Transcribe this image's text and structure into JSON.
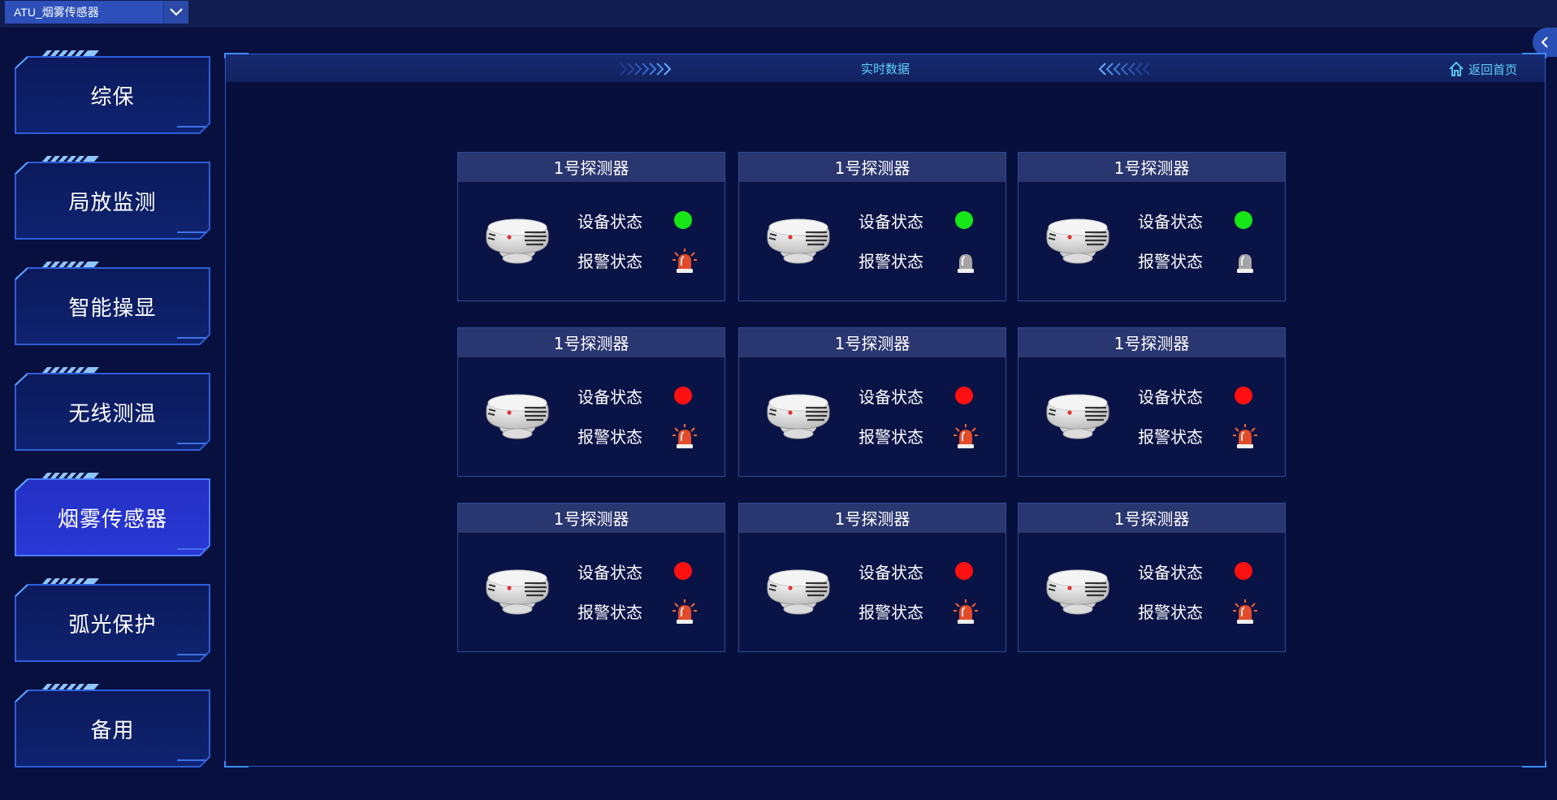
{
  "topbar": {
    "device_select_value": "ATU_烟雾传感器"
  },
  "sidebar": {
    "items": [
      {
        "label": "综保",
        "active": false
      },
      {
        "label": "局放监测",
        "active": false
      },
      {
        "label": "智能操显",
        "active": false
      },
      {
        "label": "无线测温",
        "active": false
      },
      {
        "label": "烟雾传感器",
        "active": true
      },
      {
        "label": "弧光保护",
        "active": false
      },
      {
        "label": "备用",
        "active": false
      }
    ]
  },
  "main": {
    "title": "实时数据",
    "home_label": "返回首页"
  },
  "detectors": [
    {
      "name": "1号探测器",
      "device_status_label": "设备状态",
      "alarm_status_label": "报警状态",
      "device_status": "normal",
      "alarm_status": "alarm"
    },
    {
      "name": "1号探测器",
      "device_status_label": "设备状态",
      "alarm_status_label": "报警状态",
      "device_status": "normal",
      "alarm_status": "off"
    },
    {
      "name": "1号探测器",
      "device_status_label": "设备状态",
      "alarm_status_label": "报警状态",
      "device_status": "normal",
      "alarm_status": "off"
    },
    {
      "name": "1号探测器",
      "device_status_label": "设备状态",
      "alarm_status_label": "报警状态",
      "device_status": "fault",
      "alarm_status": "alarm"
    },
    {
      "name": "1号探测器",
      "device_status_label": "设备状态",
      "alarm_status_label": "报警状态",
      "device_status": "fault",
      "alarm_status": "alarm"
    },
    {
      "name": "1号探测器",
      "device_status_label": "设备状态",
      "alarm_status_label": "报警状态",
      "device_status": "fault",
      "alarm_status": "alarm"
    },
    {
      "name": "1号探测器",
      "device_status_label": "设备状态",
      "alarm_status_label": "报警状态",
      "device_status": "fault",
      "alarm_status": "alarm"
    },
    {
      "name": "1号探测器",
      "device_status_label": "设备状态",
      "alarm_status_label": "报警状态",
      "device_status": "fault",
      "alarm_status": "alarm"
    },
    {
      "name": "1号探测器",
      "device_status_label": "设备状态",
      "alarm_status_label": "报警状态",
      "device_status": "fault",
      "alarm_status": "alarm"
    }
  ],
  "colors": {
    "status_normal": "#17e617",
    "status_fault": "#ff1010",
    "alarm_active": "#e84a2a",
    "alarm_inactive": "#a0a0a0",
    "accent": "#5fd3ff"
  },
  "icons": {
    "detector": "smoke-detector-icon",
    "alarm": "siren-icon",
    "home": "home-icon",
    "dropdown": "chevron-down-icon",
    "collapse": "chevron-left-icon"
  }
}
